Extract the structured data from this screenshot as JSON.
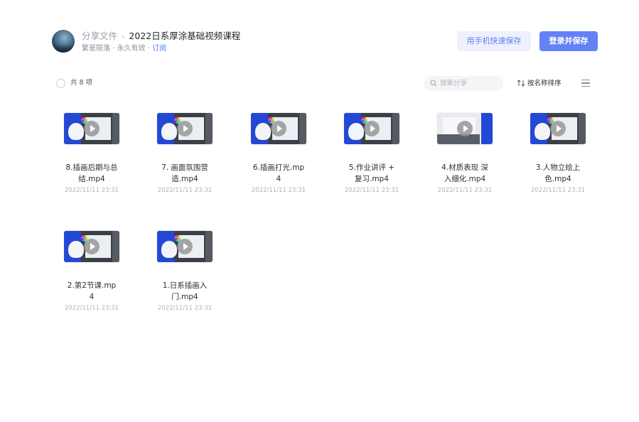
{
  "header": {
    "breadcrumb_root": "分享文件",
    "breadcrumb_sep": "›",
    "title": "2022日系厚涂基础视频课程",
    "owner": "繁星陨落",
    "validity": "永久有效",
    "subscribe": "订阅",
    "phone_save_button": "用手机快速保存",
    "login_save_button": "登录并保存"
  },
  "toolbar": {
    "count_label": "共 8 项",
    "search_placeholder": "搜索分享",
    "sort_label": "按名称排序"
  },
  "files": [
    {
      "name": "8.插画后期与总结.mp4",
      "date": "2022/11/11 23:31",
      "thumb": "blue"
    },
    {
      "name": "7. 画面氛围营造.mp4",
      "date": "2022/11/11 23:31",
      "thumb": "blue"
    },
    {
      "name": "6.插画打光.mp4",
      "date": "2022/11/11 23:31",
      "thumb": "blue"
    },
    {
      "name": "5.作业讲评 + 复习.mp4",
      "date": "2022/11/11 23:31",
      "thumb": "blue"
    },
    {
      "name": "4.材质表现 深入细化.mp4",
      "date": "2022/11/11 23:31",
      "thumb": "light"
    },
    {
      "name": "3.人物立绘上色.mp4",
      "date": "2022/11/11 23:31",
      "thumb": "blue"
    },
    {
      "name": "2.第2节课.mp4",
      "date": "2022/11/11 23:31",
      "thumb": "blue"
    },
    {
      "name": "1.日系插画入门.mp4",
      "date": "2022/11/11 23:31",
      "thumb": "blue"
    }
  ],
  "colors": {
    "accent": "#6482f6",
    "accent_light": "#eef1fd",
    "link": "#4a7cf7"
  },
  "icons": [
    "avatar",
    "search-icon",
    "sort-icon",
    "list-view-icon",
    "play-icon",
    "select-all-checkbox"
  ]
}
